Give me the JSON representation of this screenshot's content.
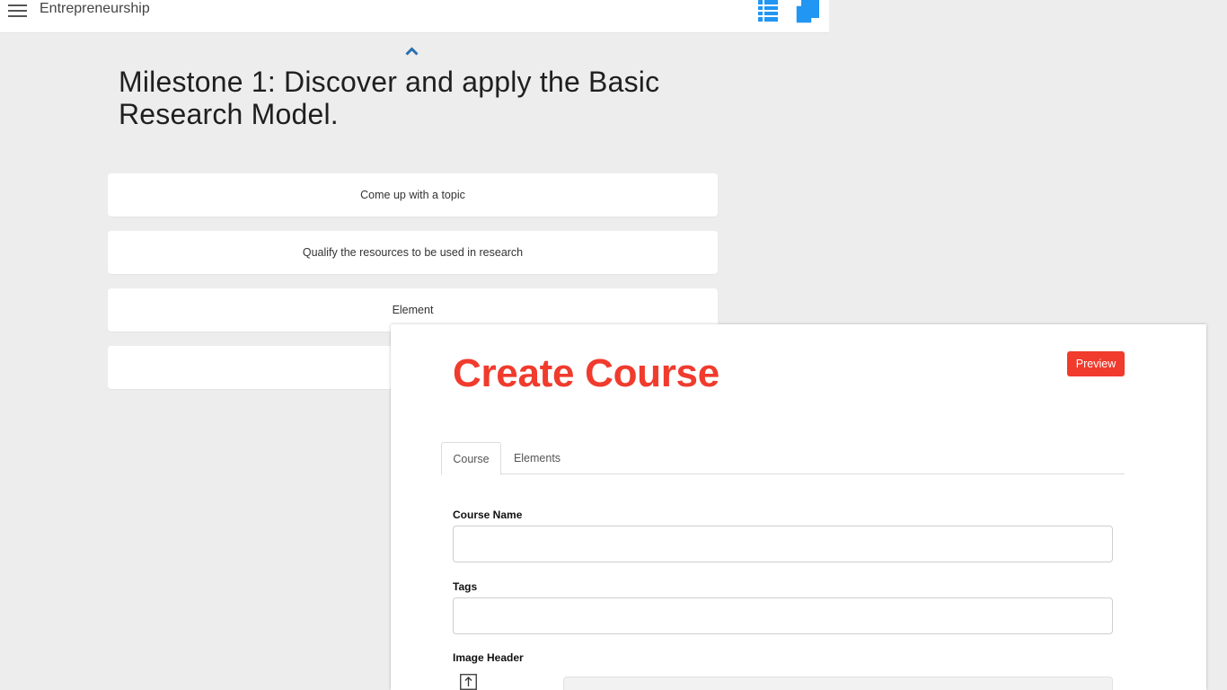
{
  "topbar": {
    "menu_icon": "hamburger-icon",
    "title": "Entrepreneurship",
    "list_icon": "list-view-icon",
    "copy_icon": "copy-pages-icon",
    "accent_color": "#2196f3"
  },
  "milestone": {
    "collapse_icon": "chevron-up-icon",
    "title": "Milestone 1: Discover and apply the Basic Research Model.",
    "items": [
      {
        "label": "Come up with a topic"
      },
      {
        "label": "Qualify the resources to be used in research"
      },
      {
        "label": "Element"
      },
      {
        "label": ""
      }
    ]
  },
  "dialog": {
    "title": "Create Course",
    "title_color": "#f03b2d",
    "preview_label": "Preview",
    "tabs": [
      {
        "label": "Course",
        "active": true
      },
      {
        "label": "Elements",
        "active": false
      }
    ],
    "fields": {
      "course_name": {
        "label": "Course Name",
        "value": ""
      },
      "tags": {
        "label": "Tags",
        "value": ""
      },
      "image_header": {
        "label": "Image Header",
        "upload_icon": "upload-icon"
      }
    }
  }
}
